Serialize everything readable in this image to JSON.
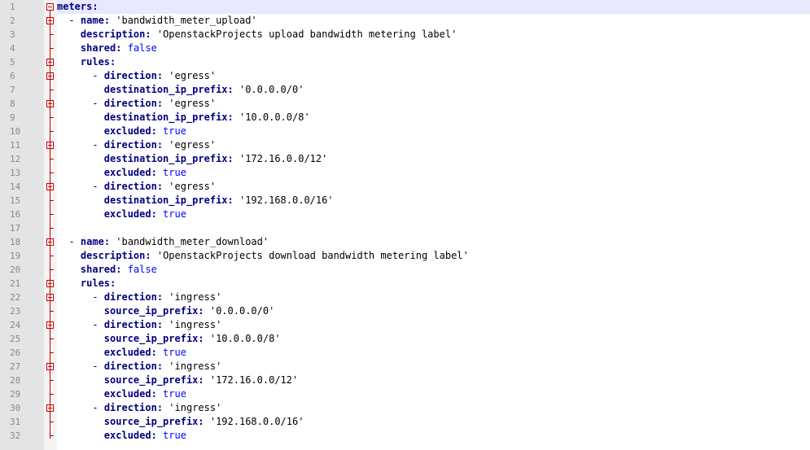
{
  "editor": {
    "lines": [
      {
        "n": "1",
        "indent": "",
        "dash": "",
        "key": "meters",
        "sep": ":",
        "value": "",
        "vtype": ""
      },
      {
        "n": "2",
        "indent": "  ",
        "dash": "- ",
        "key": "name",
        "sep": ": ",
        "value": "'bandwidth_meter_upload'",
        "vtype": "s"
      },
      {
        "n": "3",
        "indent": "    ",
        "dash": "",
        "key": "description",
        "sep": ": ",
        "value": "'OpenstackProjects upload bandwidth metering label'",
        "vtype": "s"
      },
      {
        "n": "4",
        "indent": "    ",
        "dash": "",
        "key": "shared",
        "sep": ": ",
        "value": "false",
        "vtype": "b"
      },
      {
        "n": "5",
        "indent": "    ",
        "dash": "",
        "key": "rules",
        "sep": ":",
        "value": "",
        "vtype": ""
      },
      {
        "n": "6",
        "indent": "      ",
        "dash": "- ",
        "key": "direction",
        "sep": ": ",
        "value": "'egress'",
        "vtype": "s"
      },
      {
        "n": "7",
        "indent": "        ",
        "dash": "",
        "key": "destination_ip_prefix",
        "sep": ": ",
        "value": "'0.0.0.0/0'",
        "vtype": "s"
      },
      {
        "n": "8",
        "indent": "      ",
        "dash": "- ",
        "key": "direction",
        "sep": ": ",
        "value": "'egress'",
        "vtype": "s"
      },
      {
        "n": "9",
        "indent": "        ",
        "dash": "",
        "key": "destination_ip_prefix",
        "sep": ": ",
        "value": "'10.0.0.0/8'",
        "vtype": "s"
      },
      {
        "n": "10",
        "indent": "        ",
        "dash": "",
        "key": "excluded",
        "sep": ": ",
        "value": "true",
        "vtype": "b"
      },
      {
        "n": "11",
        "indent": "      ",
        "dash": "- ",
        "key": "direction",
        "sep": ": ",
        "value": "'egress'",
        "vtype": "s"
      },
      {
        "n": "12",
        "indent": "        ",
        "dash": "",
        "key": "destination_ip_prefix",
        "sep": ": ",
        "value": "'172.16.0.0/12'",
        "vtype": "s"
      },
      {
        "n": "13",
        "indent": "        ",
        "dash": "",
        "key": "excluded",
        "sep": ": ",
        "value": "true",
        "vtype": "b"
      },
      {
        "n": "14",
        "indent": "      ",
        "dash": "- ",
        "key": "direction",
        "sep": ": ",
        "value": "'egress'",
        "vtype": "s"
      },
      {
        "n": "15",
        "indent": "        ",
        "dash": "",
        "key": "destination_ip_prefix",
        "sep": ": ",
        "value": "'192.168.0.0/16'",
        "vtype": "s"
      },
      {
        "n": "16",
        "indent": "        ",
        "dash": "",
        "key": "excluded",
        "sep": ": ",
        "value": "true",
        "vtype": "b"
      },
      {
        "n": "17",
        "indent": "",
        "dash": "",
        "key": "",
        "sep": "",
        "value": "",
        "vtype": ""
      },
      {
        "n": "18",
        "indent": "  ",
        "dash": "- ",
        "key": "name",
        "sep": ": ",
        "value": "'bandwidth_meter_download'",
        "vtype": "s"
      },
      {
        "n": "19",
        "indent": "    ",
        "dash": "",
        "key": "description",
        "sep": ": ",
        "value": "'OpenstackProjects download bandwidth metering label'",
        "vtype": "s"
      },
      {
        "n": "20",
        "indent": "    ",
        "dash": "",
        "key": "shared",
        "sep": ": ",
        "value": "false",
        "vtype": "b"
      },
      {
        "n": "21",
        "indent": "    ",
        "dash": "",
        "key": "rules",
        "sep": ":",
        "value": "",
        "vtype": ""
      },
      {
        "n": "22",
        "indent": "      ",
        "dash": "- ",
        "key": "direction",
        "sep": ": ",
        "value": "'ingress'",
        "vtype": "s"
      },
      {
        "n": "23",
        "indent": "        ",
        "dash": "",
        "key": "source_ip_prefix",
        "sep": ": ",
        "value": "'0.0.0.0/0'",
        "vtype": "s"
      },
      {
        "n": "24",
        "indent": "      ",
        "dash": "- ",
        "key": "direction",
        "sep": ": ",
        "value": "'ingress'",
        "vtype": "s"
      },
      {
        "n": "25",
        "indent": "        ",
        "dash": "",
        "key": "source_ip_prefix",
        "sep": ": ",
        "value": "'10.0.0.0/8'",
        "vtype": "s"
      },
      {
        "n": "26",
        "indent": "        ",
        "dash": "",
        "key": "excluded",
        "sep": ": ",
        "value": "true",
        "vtype": "b"
      },
      {
        "n": "27",
        "indent": "      ",
        "dash": "- ",
        "key": "direction",
        "sep": ": ",
        "value": "'ingress'",
        "vtype": "s"
      },
      {
        "n": "28",
        "indent": "        ",
        "dash": "",
        "key": "source_ip_prefix",
        "sep": ": ",
        "value": "'172.16.0.0/12'",
        "vtype": "s"
      },
      {
        "n": "29",
        "indent": "        ",
        "dash": "",
        "key": "excluded",
        "sep": ": ",
        "value": "true",
        "vtype": "b"
      },
      {
        "n": "30",
        "indent": "      ",
        "dash": "- ",
        "key": "direction",
        "sep": ": ",
        "value": "'ingress'",
        "vtype": "s"
      },
      {
        "n": "31",
        "indent": "        ",
        "dash": "",
        "key": "source_ip_prefix",
        "sep": ": ",
        "value": "'192.168.0.0/16'",
        "vtype": "s"
      },
      {
        "n": "32",
        "indent": "        ",
        "dash": "",
        "key": "excluded",
        "sep": ": ",
        "value": "true",
        "vtype": "b"
      }
    ],
    "fold_markers": [
      "1",
      "2",
      "5",
      "6",
      "8",
      "11",
      "14",
      "18",
      "21",
      "22",
      "24",
      "27",
      "30"
    ],
    "current_line": "1",
    "colors": {
      "keyword": "#000080",
      "boolean": "#0000ff",
      "string": "#000000",
      "fold": "#c00000",
      "line_number": "#8a8a8a",
      "current_line_bg": "#e8e8ff"
    }
  }
}
